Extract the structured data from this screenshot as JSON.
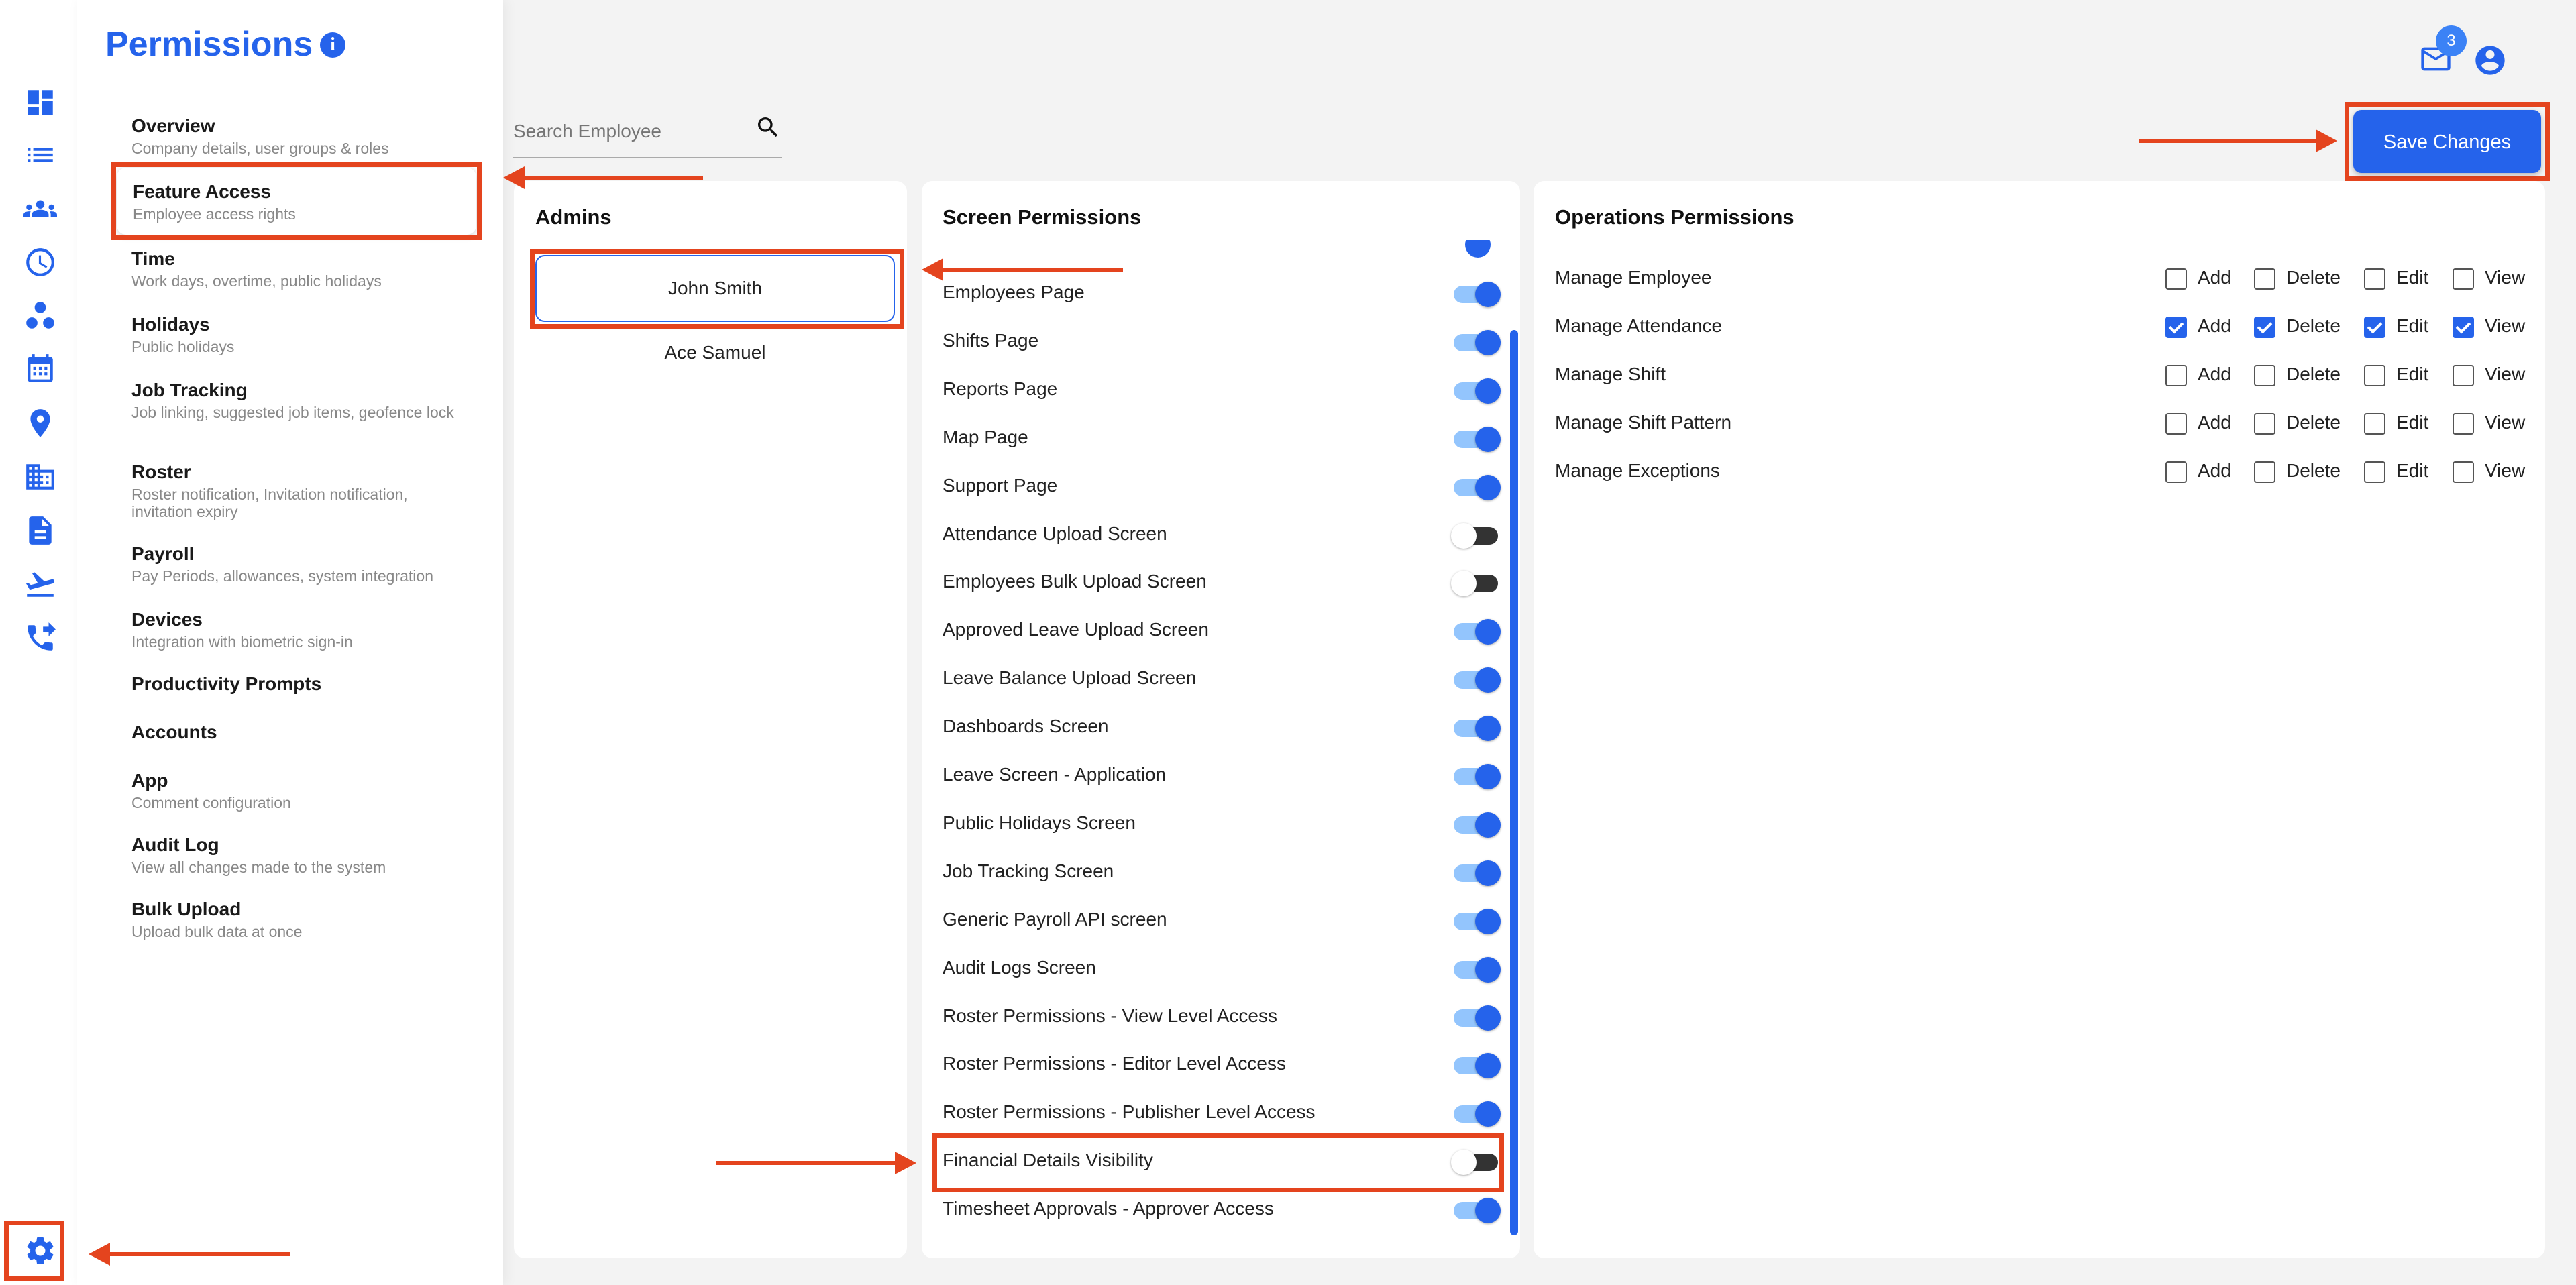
{
  "header": {
    "title": "Permissions",
    "info_icon": "info-icon",
    "notifications_count": "3",
    "mail_icon": "mail-icon",
    "account_icon": "account-circle-icon"
  },
  "rail": {
    "icons": [
      "dashboard-icon",
      "list-icon",
      "group-icon",
      "clock-icon",
      "hierarchy-icon",
      "calendar-icon",
      "location-pin-icon",
      "building-icon",
      "document-icon",
      "departure-icon",
      "phone-forward-icon",
      "settings-gear-icon"
    ]
  },
  "nav": {
    "items": [
      {
        "title": "Overview",
        "subtitle": "Company details, user groups & roles"
      },
      {
        "title": "Feature Access",
        "subtitle": "Employee access rights"
      },
      {
        "title": "Time",
        "subtitle": "Work days, overtime, public holidays"
      },
      {
        "title": "Holidays",
        "subtitle": "Public holidays"
      },
      {
        "title": "Job Tracking",
        "subtitle": "Job linking, suggested job items, geofence lock"
      },
      {
        "title": "Roster",
        "subtitle": "Roster notification, Invitation notification, invitation expiry"
      },
      {
        "title": "Payroll",
        "subtitle": "Pay Periods, allowances, system integration"
      },
      {
        "title": "Devices",
        "subtitle": "Integration with biometric sign-in"
      },
      {
        "title": "Productivity Prompts",
        "subtitle": ""
      },
      {
        "title": "Accounts",
        "subtitle": ""
      },
      {
        "title": "App",
        "subtitle": "Comment configuration"
      },
      {
        "title": "Audit Log",
        "subtitle": "View all changes made to the system"
      },
      {
        "title": "Bulk Upload",
        "subtitle": "Upload bulk data at once"
      }
    ],
    "active": "Feature Access"
  },
  "search": {
    "placeholder": "Search Employee",
    "value": ""
  },
  "admins": {
    "title": "Admins",
    "list": [
      "John Smith",
      "Ace Samuel"
    ],
    "selected": "John Smith"
  },
  "screen_permissions": {
    "title": "Screen Permissions",
    "items": [
      {
        "label": "Employees Page",
        "on": true
      },
      {
        "label": "Shifts Page",
        "on": true
      },
      {
        "label": "Reports Page",
        "on": true
      },
      {
        "label": "Map Page",
        "on": true
      },
      {
        "label": "Support Page",
        "on": true
      },
      {
        "label": "Attendance Upload Screen",
        "on": false
      },
      {
        "label": "Employees Bulk Upload Screen",
        "on": false
      },
      {
        "label": "Approved Leave Upload Screen",
        "on": true
      },
      {
        "label": "Leave Balance Upload Screen",
        "on": true
      },
      {
        "label": "Dashboards Screen",
        "on": true
      },
      {
        "label": "Leave Screen - Application",
        "on": true
      },
      {
        "label": "Public Holidays Screen",
        "on": true
      },
      {
        "label": "Job Tracking Screen",
        "on": true
      },
      {
        "label": "Generic Payroll API screen",
        "on": true
      },
      {
        "label": "Audit Logs Screen",
        "on": true
      },
      {
        "label": "Roster Permissions - View Level Access",
        "on": true
      },
      {
        "label": "Roster Permissions - Editor Level Access",
        "on": true
      },
      {
        "label": "Roster Permissions - Publisher Level Access",
        "on": true
      },
      {
        "label": "Financial Details Visibility",
        "on": false
      },
      {
        "label": "Timesheet Approvals - Approver Access",
        "on": true
      }
    ]
  },
  "operations_permissions": {
    "title": "Operations Permissions",
    "columns": [
      "Add",
      "Delete",
      "Edit",
      "View"
    ],
    "rows": [
      {
        "label": "Manage Employee",
        "checked": [
          false,
          false,
          false,
          false
        ]
      },
      {
        "label": "Manage Attendance",
        "checked": [
          true,
          true,
          true,
          true
        ]
      },
      {
        "label": "Manage Shift",
        "checked": [
          false,
          false,
          false,
          false
        ]
      },
      {
        "label": "Manage Shift Pattern",
        "checked": [
          false,
          false,
          false,
          false
        ]
      },
      {
        "label": "Manage Exceptions",
        "checked": [
          false,
          false,
          false,
          false
        ]
      }
    ]
  },
  "toolbar": {
    "save_label": "Save Changes"
  },
  "colors": {
    "accent": "#2563eb",
    "highlight": "#e4441e"
  }
}
